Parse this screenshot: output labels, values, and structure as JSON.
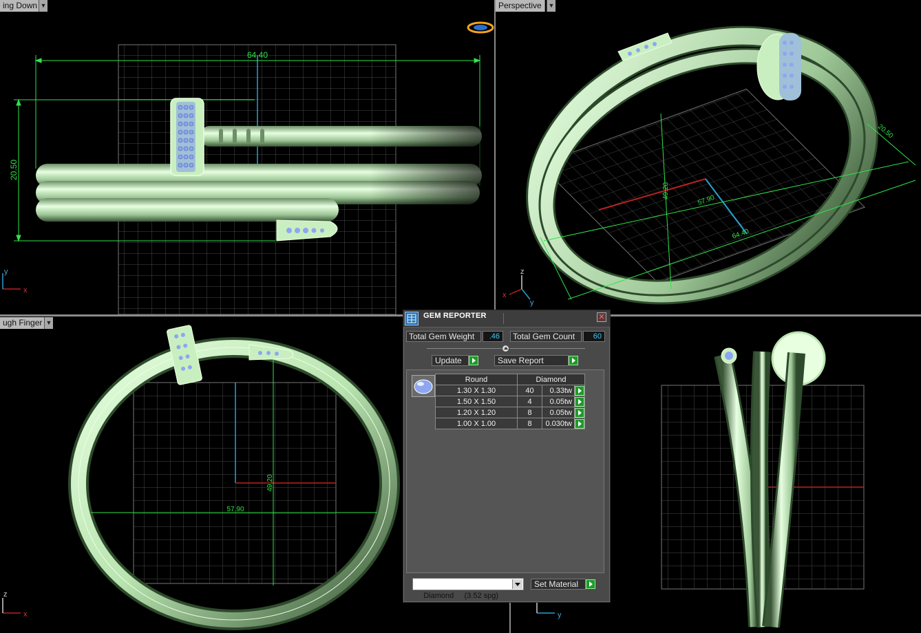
{
  "viewports": {
    "top_left": {
      "label": "ing Down"
    },
    "top_right": {
      "label": "Perspective"
    },
    "bottom_left": {
      "label": "ugh Finger"
    }
  },
  "dimensions": {
    "width": "64.40",
    "height": "20.50",
    "depth": "57.90",
    "diameter": "49.20"
  },
  "axes": {
    "x": "x",
    "y": "y",
    "z": "z"
  },
  "gem_reporter": {
    "title": "GEM REPORTER",
    "total_weight_label": "Total Gem Weight",
    "total_weight_value": ".46",
    "total_count_label": "Total Gem Count",
    "total_count_value": "60",
    "update_label": "Update",
    "save_report_label": "Save Report",
    "columns": {
      "shape": "Round",
      "material": "Diamond"
    },
    "rows": [
      {
        "size": "1.30 X 1.30",
        "count": "40",
        "weight": "0.33tw"
      },
      {
        "size": "1.50 X 1.50",
        "count": "4",
        "weight": "0.05tw"
      },
      {
        "size": "1.20 X 1.20",
        "count": "8",
        "weight": "0.05tw"
      },
      {
        "size": "1.00 X 1.00",
        "count": "8",
        "weight": "0.030tw"
      }
    ],
    "material_select": "Diamond     (3.52 spg)",
    "set_material_label": "Set Material"
  },
  "colors": {
    "model": "#b9e4b0",
    "model_shadow": "#2e4a2c",
    "dimension": "#2fe34a",
    "gem": "#8ea6f0",
    "grid": "#5a5a5a",
    "axis_red": "#c02020",
    "axis_blue": "#2aa0d0"
  }
}
